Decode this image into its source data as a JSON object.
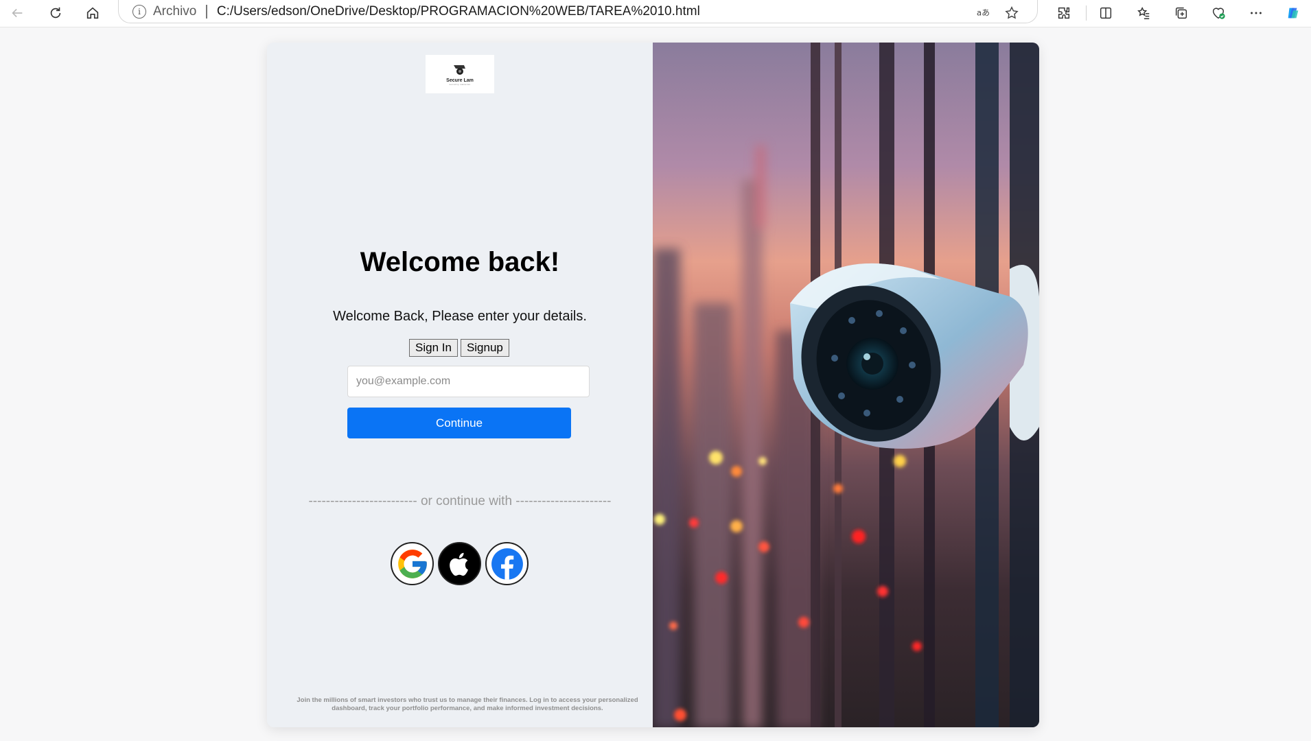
{
  "browser": {
    "scheme_label": "Archivo",
    "url": "C:/Users/edson/OneDrive/Desktop/PROGRAMACION%20WEB/TAREA%2010.html"
  },
  "logo": {
    "brand": "Secure Lam",
    "tagline": "security cameras"
  },
  "login": {
    "title": "Welcome back!",
    "subtitle": "Welcome Back, Please enter your details.",
    "tabs": [
      "Sign In",
      "Signup"
    ],
    "email_placeholder": "you@example.com",
    "continue_label": "Continue",
    "divider_text": "------------------------- or continue with ----------------------",
    "social_icons": [
      "google-icon",
      "apple-icon",
      "facebook-icon"
    ],
    "footer": "Join the millions of smart investors who trust us to manage their finances. Log in to access your personalized dashboard, track your portfolio performance, and make informed investment decisions."
  },
  "colors": {
    "primary": "#0a74f5",
    "panel_bg": "#edf0f4",
    "facebook": "#1877f2"
  }
}
